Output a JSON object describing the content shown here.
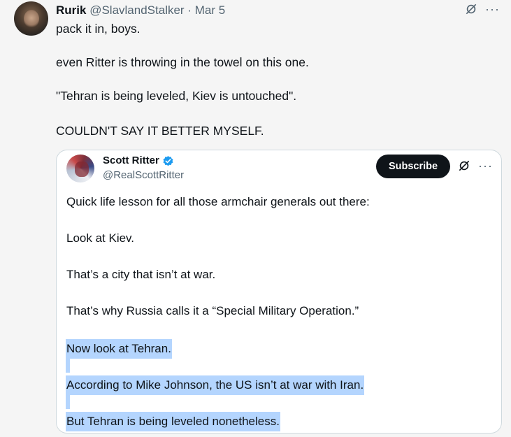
{
  "post": {
    "display_name": "Rurik",
    "handle": "@SlavlandStalker",
    "separator": "·",
    "date": "Mar 5",
    "more_icon": "more-dots-icon",
    "hide_icon": "eye-slash-icon",
    "lines": [
      "pack it in, boys.",
      "even Ritter is throwing in the towel on this one.",
      "\"Tehran is being leveled, Kiev is untouched\".",
      "COULDN'T SAY IT BETTER MYSELF."
    ]
  },
  "quoted": {
    "display_name": "Scott Ritter",
    "handle": "@RealScottRitter",
    "verified_icon": "verified-badge-icon",
    "subscribe_label": "Subscribe",
    "lines": [
      "Quick life lesson for all those armchair generals out there:",
      "Look at Kiev.",
      "That’s a city that isn’t at war.",
      "That’s why Russia calls it a “Special Military Operation.”",
      "Now look at Tehran.",
      "According to Mike Johnson, the US isn’t at war with Iran.",
      "But Tehran is being leveled nonetheless."
    ],
    "highlight_color": "#b4d5fe"
  },
  "colors": {
    "background": "#f5f5f5",
    "text": "#0f1419",
    "secondary_text": "#536471",
    "verified_blue": "#1d9bf0",
    "card_border": "#cfd9de"
  }
}
